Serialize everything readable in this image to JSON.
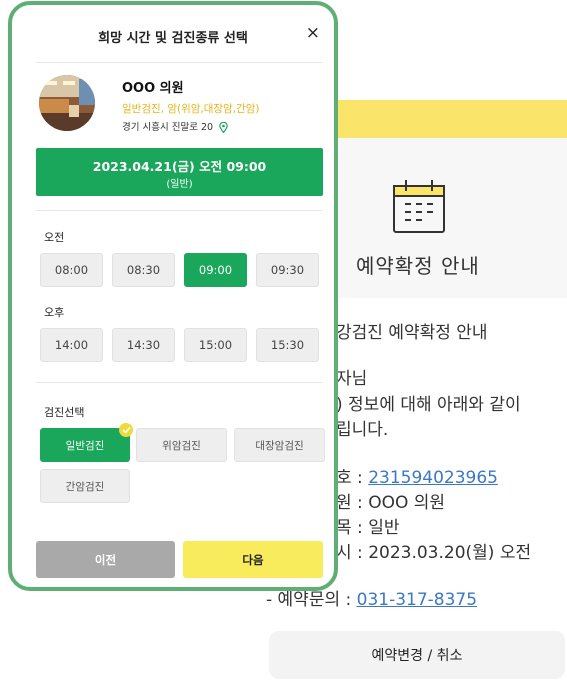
{
  "background": {
    "title": "예약확정 안내",
    "lines": [
      "강검진 예약확정 안내",
      "자님",
      ") 정보에 대해 아래와 같이",
      "립니다."
    ],
    "details": [
      {
        "prefix": "호 : ",
        "value": "231594023965",
        "link": true
      },
      {
        "prefix": "원 : ",
        "value": "OOO 의원",
        "link": false
      },
      {
        "prefix": "목 : ",
        "value": "일반",
        "link": false
      },
      {
        "prefix": "시 : ",
        "value": "2023.03.20(월) 오전",
        "link": false
      },
      {
        "prefix": "- 예약문의 : ",
        "value": "031-317-8375",
        "link": true
      }
    ],
    "change_button": "예약변경 / 취소"
  },
  "modal": {
    "title": "희망 시간 및 검진종류 선택",
    "close": "×",
    "clinic": {
      "name": "OOO 의원",
      "types": "일반검진, 암(위암,대장암,간암)",
      "address": "경기 시흥시 진말로 20"
    },
    "selected": {
      "datetime": "2023.04.21(금) 오전 09:00",
      "type": "(일반)"
    },
    "morning_label": "오전",
    "morning_slots": [
      "08:00",
      "08:30",
      "09:00",
      "09:30"
    ],
    "morning_selected": "09:00",
    "afternoon_label": "오후",
    "afternoon_slots": [
      "14:00",
      "14:30",
      "15:00",
      "15:30"
    ],
    "checkup_label": "검진선택",
    "checkups": [
      "일반검진",
      "위암검진",
      "대장암검진",
      "간암검진"
    ],
    "checkup_selected": "일반검진",
    "prev_button": "이전",
    "next_button": "다음"
  },
  "colors": {
    "green": "#1aa65b",
    "yellow": "#f8ec5c",
    "modal_border": "#5fae73",
    "link": "#3b78c8"
  }
}
